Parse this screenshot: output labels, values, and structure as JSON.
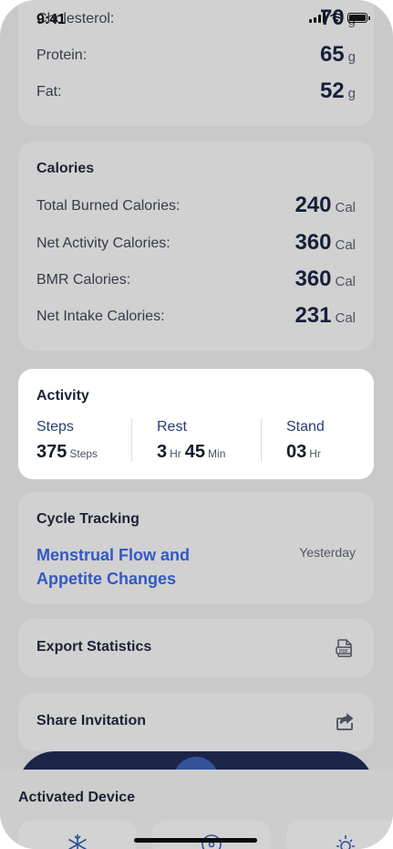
{
  "status_bar": {
    "time": "9:41"
  },
  "nutrition_rows": [
    {
      "label": "Cholesterol:",
      "value": "70",
      "unit": "g"
    },
    {
      "label": "Protein:",
      "value": "65",
      "unit": "g"
    },
    {
      "label": "Fat:",
      "value": "52",
      "unit": "g"
    }
  ],
  "calories": {
    "title": "Calories",
    "rows": [
      {
        "label": "Total Burned Calories:",
        "value": "240",
        "unit": "Cal"
      },
      {
        "label": "Net Activity Calories:",
        "value": "360",
        "unit": "Cal"
      },
      {
        "label": "BMR Calories:",
        "value": "360",
        "unit": "Cal"
      },
      {
        "label": "Net Intake Calories:",
        "value": "231",
        "unit": "Cal"
      }
    ]
  },
  "activity": {
    "title": "Activity",
    "steps": {
      "label": "Steps",
      "value": "375",
      "unit": "Steps"
    },
    "rest": {
      "label": "Rest",
      "hours": "3",
      "hours_unit": "Hr",
      "minutes": "45",
      "minutes_unit": "Min"
    },
    "stand": {
      "label": "Stand",
      "value": "03",
      "unit": "Hr"
    }
  },
  "cycle": {
    "title": "Cycle Tracking",
    "entry": "Menstrual Flow and Appetite Changes",
    "when": "Yesterday"
  },
  "export": {
    "label": "Export Statistics",
    "icon": "pdf-file-icon"
  },
  "share": {
    "label": "Share Invitation",
    "icon": "share-icon"
  },
  "bottom_sheet": {
    "title": "Activated Device"
  },
  "colors": {
    "accent": "#3159c7",
    "dark_navy": "#1a2547",
    "overlay": "#c9c9c9"
  }
}
